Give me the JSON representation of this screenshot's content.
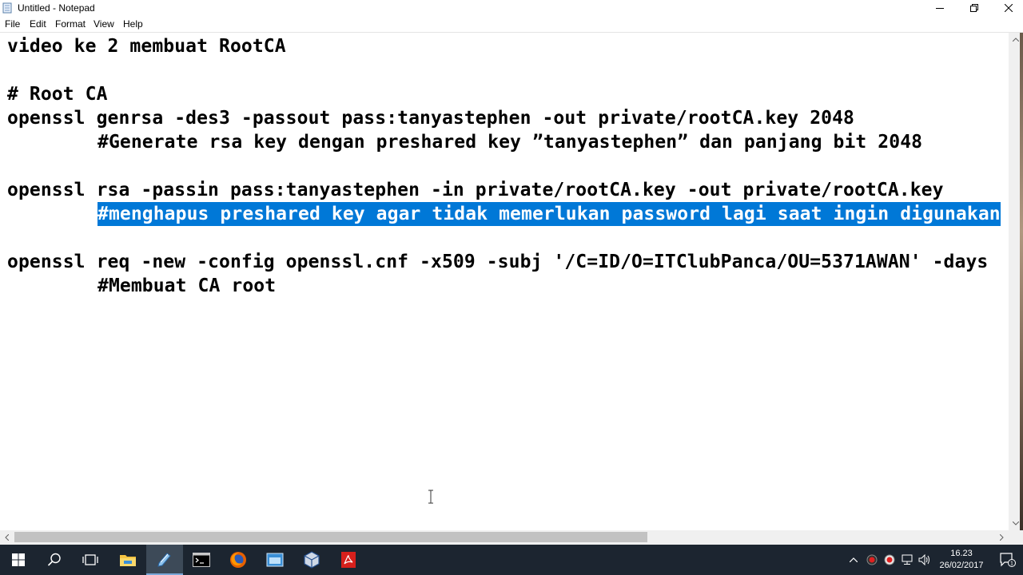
{
  "window": {
    "title": "Untitled - Notepad",
    "app_icon": "notepad-icon",
    "controls": [
      "minimize-icon",
      "maximize-icon",
      "close-icon"
    ]
  },
  "menu": {
    "file": "File",
    "edit": "Edit",
    "format": "Format",
    "view": "View",
    "help": "Help"
  },
  "editor": {
    "lines": [
      "video ke 2 membuat RootCA",
      "",
      "# Root CA",
      "openssl genrsa -des3 -passout pass:tanyastephen -out private/rootCA.key 2048",
      "#Generate rsa key dengan preshared key ”tanyastephen” dan panjang bit 2048",
      "",
      "openssl rsa -passin pass:tanyastephen -in private/rootCA.key -out private/rootCA.key",
      "#menghapus preshared key agar tidak memerlukan password lagi saat ingin digunakan",
      "",
      "openssl req -new -config openssl.cnf -x509 -subj '/C=ID/O=ITClubPanca/OU=5371AWAN' -days",
      "#Membuat CA root"
    ],
    "selected_line_index": 7,
    "selection_color": "#0078d7"
  },
  "taskbar": {
    "background": "#1c2530",
    "buttons": [
      "windows-start-icon",
      "search-icon",
      "task-view-icon",
      "file-explorer-icon",
      "notepad-icon",
      "command-prompt-icon",
      "firefox-icon",
      "app-window-icon",
      "virtualbox-icon",
      "acrobat-icon"
    ],
    "tray_icons": [
      "chevron-up-icon",
      "record-icon",
      "record-icon",
      "network-icon",
      "volume-icon",
      "keyboard-icon"
    ],
    "clock_time": "16.23",
    "clock_date": "26/02/2017",
    "notification_count": "1"
  }
}
